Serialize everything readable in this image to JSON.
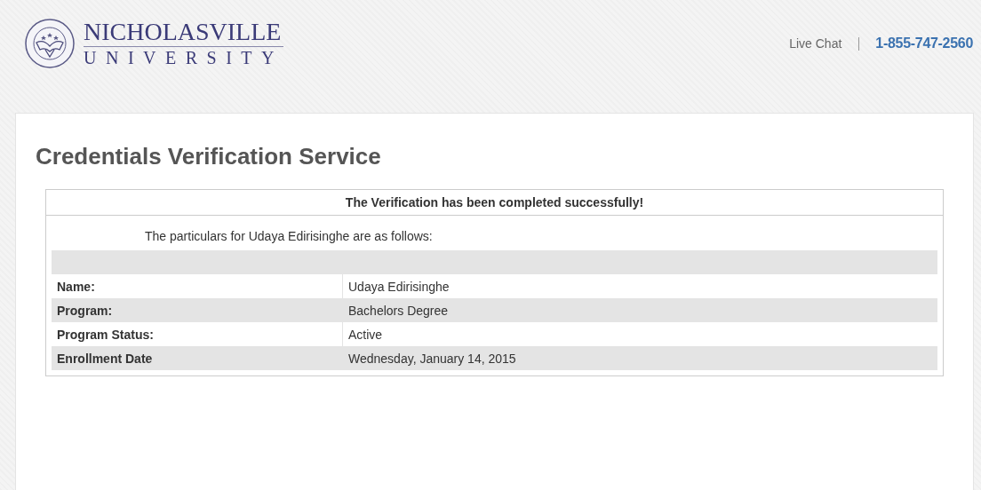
{
  "header": {
    "logo": {
      "name": "NICHOLASVILLE",
      "subtitle": "UNIVERSITY"
    },
    "live_chat": "Live Chat",
    "phone": "1-855-747-2560"
  },
  "page": {
    "title": "Credentials Verification Service",
    "status_message": "The Verification has been completed successfully!",
    "intro": "The particulars for Udaya Edirisinghe are as follows:",
    "rows": [
      {
        "label": "Name:",
        "value": "Udaya Edirisinghe"
      },
      {
        "label": "Program:",
        "value": "Bachelors Degree"
      },
      {
        "label": "Program Status:",
        "value": "Active"
      },
      {
        "label": "Enrollment Date",
        "value": "Wednesday, January 14, 2015"
      }
    ]
  }
}
